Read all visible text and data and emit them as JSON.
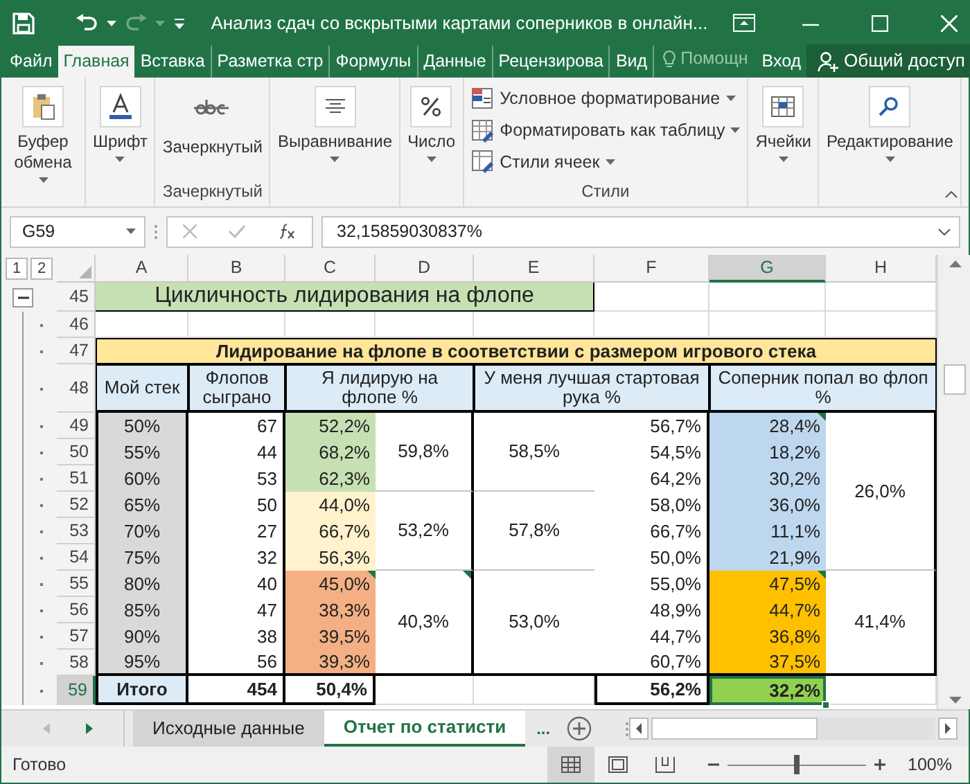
{
  "window": {
    "title": "Анализ сдач со вскрытыми картами соперников в онлайн..."
  },
  "ribbon_tabs": [
    {
      "label": "Файл",
      "selected": false
    },
    {
      "label": "Главная",
      "selected": true
    },
    {
      "label": "Вставка",
      "selected": false
    },
    {
      "label": "Разметка стр",
      "selected": false
    },
    {
      "label": "Формулы",
      "selected": false
    },
    {
      "label": "Данные",
      "selected": false
    },
    {
      "label": "Рецензирова",
      "selected": false
    },
    {
      "label": "Вид",
      "selected": false
    }
  ],
  "tell_me": "Помощн",
  "sign_in": "Вход",
  "share": "Общий доступ",
  "ribbon_groups": [
    {
      "buttons": [
        {
          "kind": "clipboard",
          "label": "Буфер обмена",
          "dropdown": true
        }
      ]
    },
    {
      "buttons": [
        {
          "kind": "font",
          "label": "Шрифт",
          "dropdown": true
        }
      ]
    },
    {
      "label": "Зачеркнутый",
      "buttons": [
        {
          "kind": "strike",
          "label": "Зачеркнутый",
          "dropdown": false
        }
      ]
    },
    {
      "buttons": [
        {
          "kind": "align",
          "label": "Выравнивание",
          "dropdown": true
        }
      ]
    },
    {
      "buttons": [
        {
          "kind": "number",
          "label": "Число",
          "dropdown": true
        }
      ]
    },
    {
      "label": "Стили",
      "buttons": [
        {
          "kind": "conditional",
          "label": "Условное форматирование",
          "dropdown": true
        },
        {
          "kind": "table_format",
          "label": "Форматировать как таблицу",
          "dropdown": true
        },
        {
          "kind": "cell_styles",
          "label": "Стили ячеек",
          "dropdown": true
        }
      ]
    },
    {
      "buttons": [
        {
          "kind": "cells",
          "label": "Ячейки",
          "dropdown": true
        }
      ]
    },
    {
      "buttons": [
        {
          "kind": "find",
          "label": "Редактирование",
          "dropdown": true
        }
      ]
    }
  ],
  "formula_bar": {
    "name_box": "G59",
    "formula": "32,15859030837%"
  },
  "sheet": {
    "outline_levels": [
      "1",
      "2"
    ],
    "columns": [
      {
        "label": "A",
        "selected": false
      },
      {
        "label": "B",
        "selected": false
      },
      {
        "label": "C",
        "selected": false
      },
      {
        "label": "D",
        "selected": false
      },
      {
        "label": "E",
        "selected": false
      },
      {
        "label": "F",
        "selected": false
      },
      {
        "label": "G",
        "selected": true
      },
      {
        "label": "H",
        "selected": false
      }
    ],
    "rows": [
      {
        "label": "45",
        "selected": false
      },
      {
        "label": "46",
        "selected": false
      },
      {
        "label": "47",
        "selected": false
      },
      {
        "label": "48",
        "selected": false
      },
      {
        "label": "49",
        "selected": false
      },
      {
        "label": "50",
        "selected": false
      },
      {
        "label": "51",
        "selected": false
      },
      {
        "label": "52",
        "selected": false
      },
      {
        "label": "53",
        "selected": false
      },
      {
        "label": "54",
        "selected": false
      },
      {
        "label": "55",
        "selected": false
      },
      {
        "label": "56",
        "selected": false
      },
      {
        "label": "57",
        "selected": false
      },
      {
        "label": "58",
        "selected": false
      },
      {
        "label": "59",
        "selected": true
      }
    ],
    "title": "Цикличность лидирования на флопе",
    "banner": "Лидирование на флопе в соответствии с размером игрового стека",
    "headers": [
      "Мой стек",
      "Флопов сыграно",
      "Я лидирую на флопе %",
      "У меня лучшая стартовая рука %",
      "Соперник попал во флоп %"
    ],
    "lead_groups": [
      {
        "color": "#c6e0b4",
        "lead_avg": "59,8%",
        "hand_avg": "58,5%",
        "avg_comment": false,
        "rows": [
          {
            "stack": "50%",
            "flops": "67",
            "lead": "52,2%",
            "best_hand": "56,7%",
            "comment": false
          },
          {
            "stack": "55%",
            "flops": "44",
            "lead": "68,2%",
            "best_hand": "54,5%",
            "comment": false
          },
          {
            "stack": "60%",
            "flops": "53",
            "lead": "62,3%",
            "best_hand": "64,2%",
            "comment": false
          }
        ]
      },
      {
        "color": "#fff2cc",
        "lead_avg": "53,2%",
        "hand_avg": "57,8%",
        "avg_comment": false,
        "rows": [
          {
            "stack": "65%",
            "flops": "50",
            "lead": "44,0%",
            "best_hand": "58,0%",
            "comment": false
          },
          {
            "stack": "70%",
            "flops": "27",
            "lead": "66,7%",
            "best_hand": "66,7%",
            "comment": false
          },
          {
            "stack": "75%",
            "flops": "32",
            "lead": "56,3%",
            "best_hand": "50,0%",
            "comment": false
          }
        ]
      },
      {
        "color": "#f4b084",
        "lead_avg": "40,3%",
        "hand_avg": "53,0%",
        "avg_comment": true,
        "rows": [
          {
            "stack": "80%",
            "flops": "40",
            "lead": "45,0%",
            "best_hand": "55,0%",
            "comment": true
          },
          {
            "stack": "85%",
            "flops": "47",
            "lead": "38,3%",
            "best_hand": "48,9%",
            "comment": false
          },
          {
            "stack": "90%",
            "flops": "38",
            "lead": "39,5%",
            "best_hand": "44,7%",
            "comment": false
          },
          {
            "stack": "95%",
            "flops": "56",
            "lead": "39,3%",
            "best_hand": "60,7%",
            "comment": false
          }
        ]
      }
    ],
    "hit_groups": [
      {
        "color": "#bdd7ee",
        "avg": "26,0%",
        "values": [
          {
            "value": "28,4%",
            "comment": true
          },
          {
            "value": "18,2%",
            "comment": false
          },
          {
            "value": "30,2%",
            "comment": false
          },
          {
            "value": "36,0%",
            "comment": false
          },
          {
            "value": "11,1%",
            "comment": false
          },
          {
            "value": "21,9%",
            "comment": false
          }
        ]
      },
      {
        "color": "#ffc000",
        "avg": "41,4%",
        "values": [
          {
            "value": "47,5%",
            "comment": true
          },
          {
            "value": "44,7%",
            "comment": false
          },
          {
            "value": "36,8%",
            "comment": false
          },
          {
            "value": "37,5%",
            "comment": false
          }
        ]
      }
    ],
    "total": {
      "label": "Итого",
      "flops": "454",
      "lead": "50,4%",
      "best_hand": "56,2%",
      "hit": {
        "value": "32,2%",
        "color": "#92d050",
        "selected": true
      }
    }
  },
  "sheet_tabs": [
    {
      "label": "Исходные данные",
      "selected": false
    },
    {
      "label": "Отчет по статисти",
      "selected": true
    }
  ],
  "more_tabs": "...",
  "status": "Готово",
  "views": [
    {
      "kind": "normal",
      "selected": true
    },
    {
      "kind": "page_layout",
      "selected": false
    },
    {
      "kind": "page_break",
      "selected": false
    }
  ],
  "zoom": {
    "level": 0.5,
    "reading": "100%"
  }
}
